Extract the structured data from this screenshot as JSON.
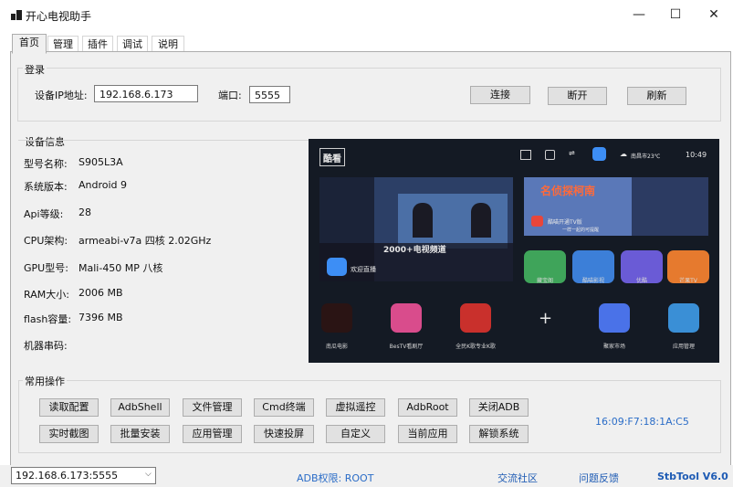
{
  "window": {
    "title": "开心电视助手",
    "minimize": "—",
    "maximize": "☐",
    "close": "✕"
  },
  "tabs": [
    "首页",
    "管理",
    "插件",
    "调试",
    "说明"
  ],
  "login": {
    "group_label": "登录",
    "ip_label": "设备IP地址:",
    "ip_value": "192.168.6.173",
    "port_label": "端口:",
    "port_value": "5555",
    "connect": "连接",
    "disconnect": "断开",
    "refresh": "刷新"
  },
  "device_info": {
    "group_label": "设备信息",
    "rows": [
      {
        "label": "型号名称:",
        "value": "S905L3A"
      },
      {
        "label": "系统版本:",
        "value": "Android 9"
      },
      {
        "label": "Api等级:",
        "value": "28"
      },
      {
        "label": "CPU架构:",
        "value": "armeabi-v7a 四核 2.02GHz"
      },
      {
        "label": "GPU型号:",
        "value": "Mali-450 MP 八核"
      },
      {
        "label": "RAM大小:",
        "value": "2006 MB"
      },
      {
        "label": "flash容量:",
        "value": "7396 MB"
      },
      {
        "label": "机器串码:",
        "value": ""
      }
    ]
  },
  "tv_screen": {
    "logo": "酷看",
    "weather": "南昌市23℃",
    "time": "10:49",
    "banner_text": "2000+电视频道",
    "live_label": "欢迎直播",
    "promo_title": "名侦探柯南",
    "promo_sub": "酷喵开通TV版",
    "promo_sub2": "一样一起的可提醒",
    "mini_apps": [
      "藏宝阁",
      "酷喵影视",
      "优酷",
      "芒果TV"
    ],
    "bottom_apps": [
      "南瓜电影",
      "BesTV看剧厅",
      "全民K歌专业K歌",
      "",
      "聚家市场",
      "应用管理"
    ],
    "colors": {
      "accent": "#e8463a",
      "bg": "#141a24"
    }
  },
  "ops": {
    "group_label": "常用操作",
    "row1": [
      "读取配置",
      "AdbShell",
      "文件管理",
      "Cmd终端",
      "虚拟遥控",
      "AdbRoot",
      "关闭ADB"
    ],
    "row2": [
      "实时截图",
      "批量安装",
      "应用管理",
      "快速投屏",
      "自定义",
      "当前应用",
      "解锁系统"
    ],
    "mac": "16:09:F7:18:1A:C5"
  },
  "status": {
    "device_select": "192.168.6.173:5555",
    "adb_perm": "ADB权限: ROOT",
    "community": "交流社区",
    "feedback": "问题反馈",
    "version": "StbTool V6.0"
  },
  "colors": {
    "link_blue": "#1e5bb4",
    "status_blue": "#2a6cc7"
  }
}
